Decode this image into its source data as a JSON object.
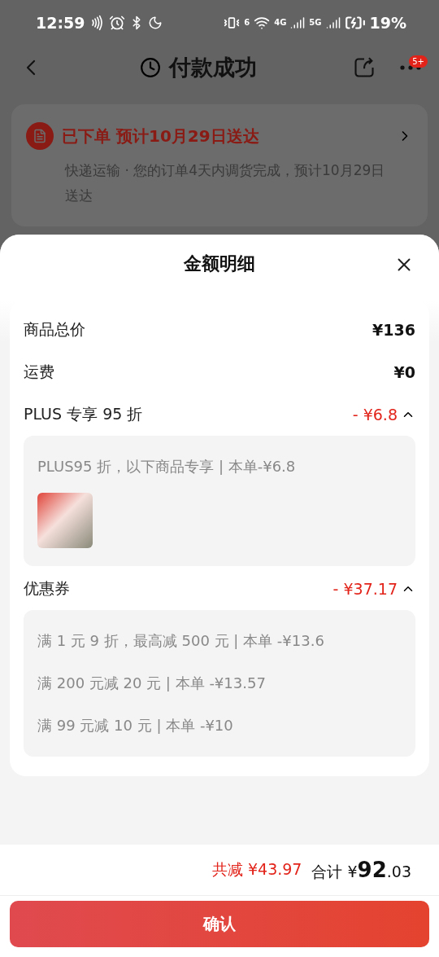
{
  "status_bar": {
    "time": "12:59",
    "wifi_label": "6",
    "network_labels": [
      "4G",
      "5G"
    ],
    "battery": "19%"
  },
  "header": {
    "title": "付款成功",
    "badge": "5+"
  },
  "order_card": {
    "status": "已下单",
    "eta": "预计10月29日送达",
    "description": "快递运输 · 您的订单4天内调货完成，预计10月29日送达"
  },
  "sheet": {
    "title": "金额明细",
    "rows": [
      {
        "kind": "plain",
        "label": "商品总价",
        "amount": "¥136"
      },
      {
        "kind": "plain",
        "label": "运费",
        "amount": "¥0"
      },
      {
        "kind": "discount",
        "label": "PLUS 专享 95 折",
        "amount": "- ¥6.8",
        "expanded": true,
        "details": [
          "PLUS95 折，以下商品专享 | 本单-¥6.8"
        ],
        "product_image": true
      },
      {
        "kind": "discount",
        "label": "优惠券",
        "amount": "- ¥37.17",
        "expanded": true,
        "details": [
          "满 1 元 9 折，最高减 500 元 | 本单 -¥13.6",
          "满 200 元减 20 元 | 本单 -¥13.57",
          "满 99 元减 10 元 | 本单 -¥10"
        ]
      }
    ]
  },
  "footer": {
    "saved_label": "共减",
    "saved_amount": "¥43.97",
    "total_label": "合计",
    "total_currency": "¥",
    "total_integer": "92",
    "total_decimal": ".03"
  },
  "confirm_button": "确认"
}
